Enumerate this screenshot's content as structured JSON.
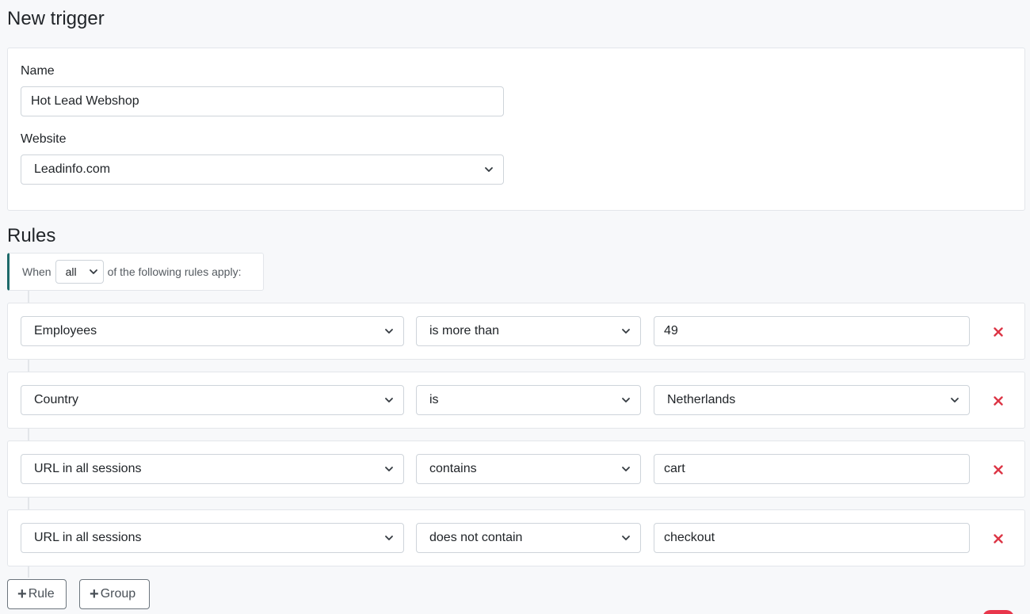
{
  "page": {
    "title": "New trigger",
    "rules_title": "Rules"
  },
  "general": {
    "name_label": "Name",
    "name_value": "Hot Lead Webshop",
    "website_label": "Website",
    "website_value": "Leadinfo.com"
  },
  "match": {
    "prefix": "When",
    "value": "all",
    "suffix": "of the following rules apply:"
  },
  "rules": [
    {
      "field": "Employees",
      "operator": "is more than",
      "value": "49",
      "value_type": "text"
    },
    {
      "field": "Country",
      "operator": "is",
      "value": "Netherlands",
      "value_type": "select"
    },
    {
      "field": "URL in all sessions",
      "operator": "contains",
      "value": "cart",
      "value_type": "text"
    },
    {
      "field": "URL in all sessions",
      "operator": "does not contain",
      "value": "checkout",
      "value_type": "text"
    }
  ],
  "buttons": {
    "add_rule": "Rule",
    "add_group": "Group"
  },
  "colors": {
    "accent": "#1d6a6a",
    "delete": "#dc3545",
    "border": "#ced4da"
  }
}
